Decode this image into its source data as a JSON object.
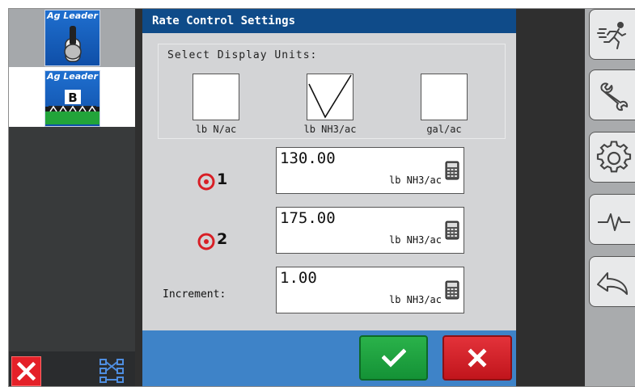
{
  "sidebar": {
    "app_tiles": [
      {
        "brand": "Ag Leader",
        "icon": "toggle-switch-icon"
      },
      {
        "brand": "Ag Leader",
        "icon": "boom-b-icon",
        "letter": "B"
      }
    ],
    "bottom_buttons": [
      {
        "icon": "close-icon",
        "color": "#e42028"
      },
      {
        "icon": "map-switch-icon"
      }
    ]
  },
  "dialog": {
    "title": "Rate Control Settings",
    "units": {
      "label": "Select Display Units:",
      "options": [
        {
          "label": "lb N/ac",
          "checked": false
        },
        {
          "label": "lb NH3/ac",
          "checked": true
        },
        {
          "label": "gal/ac",
          "checked": false
        }
      ]
    },
    "rates": [
      {
        "label": "1",
        "value": "130.00",
        "unit": "lb NH3/ac",
        "icon": "target-icon"
      },
      {
        "label": "2",
        "value": "175.00",
        "unit": "lb NH3/ac",
        "icon": "target-icon"
      }
    ],
    "increment": {
      "label": "Increment:",
      "value": "1.00",
      "unit": "lb NH3/ac"
    },
    "buttons": {
      "ok_icon": "checkmark-icon",
      "cancel_icon": "close-icon"
    }
  },
  "right_rail": {
    "buttons": [
      "running-person-icon",
      "wrench-icon",
      "gear-icon",
      "diagnostics-icon",
      "back-icon"
    ]
  },
  "colors": {
    "title_bar": "#0f4b89",
    "footer": "#3e83c8",
    "ok": "#1fa240",
    "cancel": "#d0222a",
    "accent_red": "#e42028"
  }
}
